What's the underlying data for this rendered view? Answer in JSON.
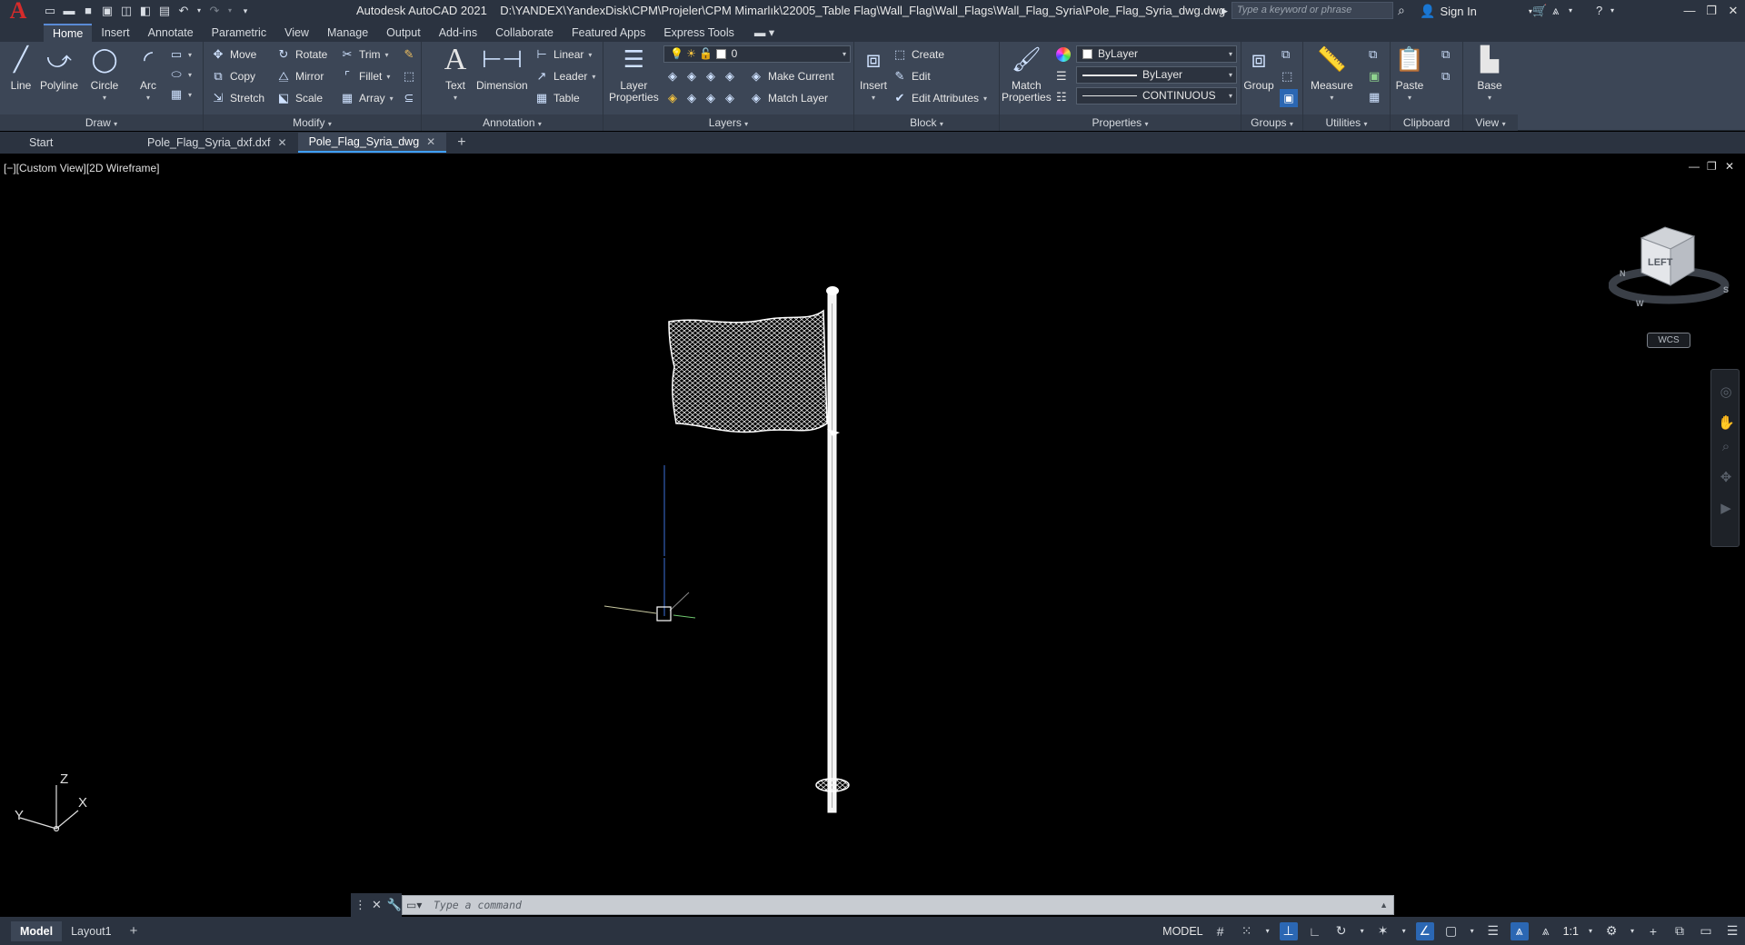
{
  "titlebar": {
    "logo": "A",
    "app_name": "Autodesk AutoCAD 2021",
    "file_path": "D:\\YANDEX\\YandexDisk\\CPM\\Projeler\\CPM Mimarlık\\22005_Table Flag\\Wall_Flag\\Wall_Flags\\Wall_Flag_Syria\\Pole_Flag_Syria_dwg.dwg",
    "search_placeholder": "Type a keyword or phrase",
    "sign_in": "Sign In"
  },
  "ribbon_tabs": [
    "Home",
    "Insert",
    "Annotate",
    "Parametric",
    "View",
    "Manage",
    "Output",
    "Add-ins",
    "Collaborate",
    "Featured Apps",
    "Express Tools"
  ],
  "panels": {
    "draw": {
      "title": "Draw",
      "line": "Line",
      "polyline": "Polyline",
      "circle": "Circle",
      "arc": "Arc"
    },
    "modify": {
      "title": "Modify",
      "move": "Move",
      "rotate": "Rotate",
      "trim": "Trim",
      "copy": "Copy",
      "mirror": "Mirror",
      "fillet": "Fillet",
      "stretch": "Stretch",
      "scale": "Scale",
      "array": "Array"
    },
    "annotation": {
      "title": "Annotation",
      "text": "Text",
      "dimension": "Dimension",
      "linear": "Linear",
      "leader": "Leader",
      "table": "Table"
    },
    "layers": {
      "title": "Layers",
      "layer_properties_1": "Layer",
      "layer_properties_2": "Properties",
      "current_layer": "0",
      "make_current": "Make Current",
      "match_layer": "Match Layer"
    },
    "block": {
      "title": "Block",
      "insert": "Insert",
      "create": "Create",
      "edit": "Edit",
      "edit_attributes": "Edit Attributes"
    },
    "properties": {
      "title": "Properties",
      "match_1": "Match",
      "match_2": "Properties",
      "color": "ByLayer",
      "lineweight": "ByLayer",
      "linetype": "CONTINUOUS"
    },
    "groups": {
      "title": "Groups",
      "group": "Group"
    },
    "utilities": {
      "title": "Utilities",
      "measure": "Measure"
    },
    "clipboard": {
      "title": "Clipboard",
      "paste": "Paste"
    },
    "view": {
      "title": "View",
      "base": "Base"
    }
  },
  "file_tabs": [
    {
      "label": "Start"
    },
    {
      "label": "Pole_Flag_Syria_dxf.dxf"
    },
    {
      "label": "Pole_Flag_Syria_dwg"
    }
  ],
  "viewport": {
    "label": "[−][Custom View][2D Wireframe]",
    "viewcube_face": "LEFT",
    "compass_n": "N",
    "compass_s": "S",
    "compass_w": "W",
    "wcs": "WCS",
    "ucs_z": "Z",
    "ucs_y": "Y",
    "ucs_x": "X"
  },
  "command": {
    "placeholder": "Type a command"
  },
  "status": {
    "layout_tabs": [
      "Model",
      "Layout1"
    ],
    "model": "MODEL",
    "scale": "1:1"
  },
  "colors": {
    "ribbon_bg": "#3c4656",
    "titlebar_bg": "#2b3340",
    "accent": "#3fa0ff",
    "status_on": "#2b67b3"
  }
}
